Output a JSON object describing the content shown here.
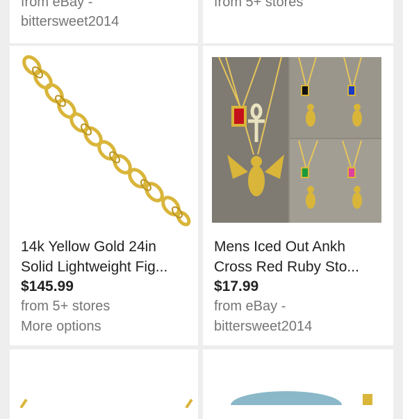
{
  "top_cards": {
    "left": {
      "line1": "from eBay -",
      "line2": "bittersweet2014"
    },
    "right": {
      "line1": "from 5+ stores"
    }
  },
  "products": [
    {
      "title_line1": "14k Yellow Gold 24in",
      "title_line2": "Solid Lightweight Fig...",
      "price": "$145.99",
      "source": "from 5+ stores",
      "extra": "More options",
      "image_icon": "gold-chain-bracelet-image"
    },
    {
      "title_line1": "Mens Iced Out Ankh",
      "title_line2": "Cross Red Ruby Sto...",
      "price": "$17.99",
      "source": "from eBay -",
      "extra": "bittersweet2014",
      "image_icon": "pendant-necklace-set-image"
    }
  ],
  "colors": {
    "background": "#eeeeee",
    "card": "#ffffff",
    "text": "#222222",
    "secondary_text": "#757575",
    "gold": "#d9b53a",
    "ruby": "#c4121a"
  }
}
